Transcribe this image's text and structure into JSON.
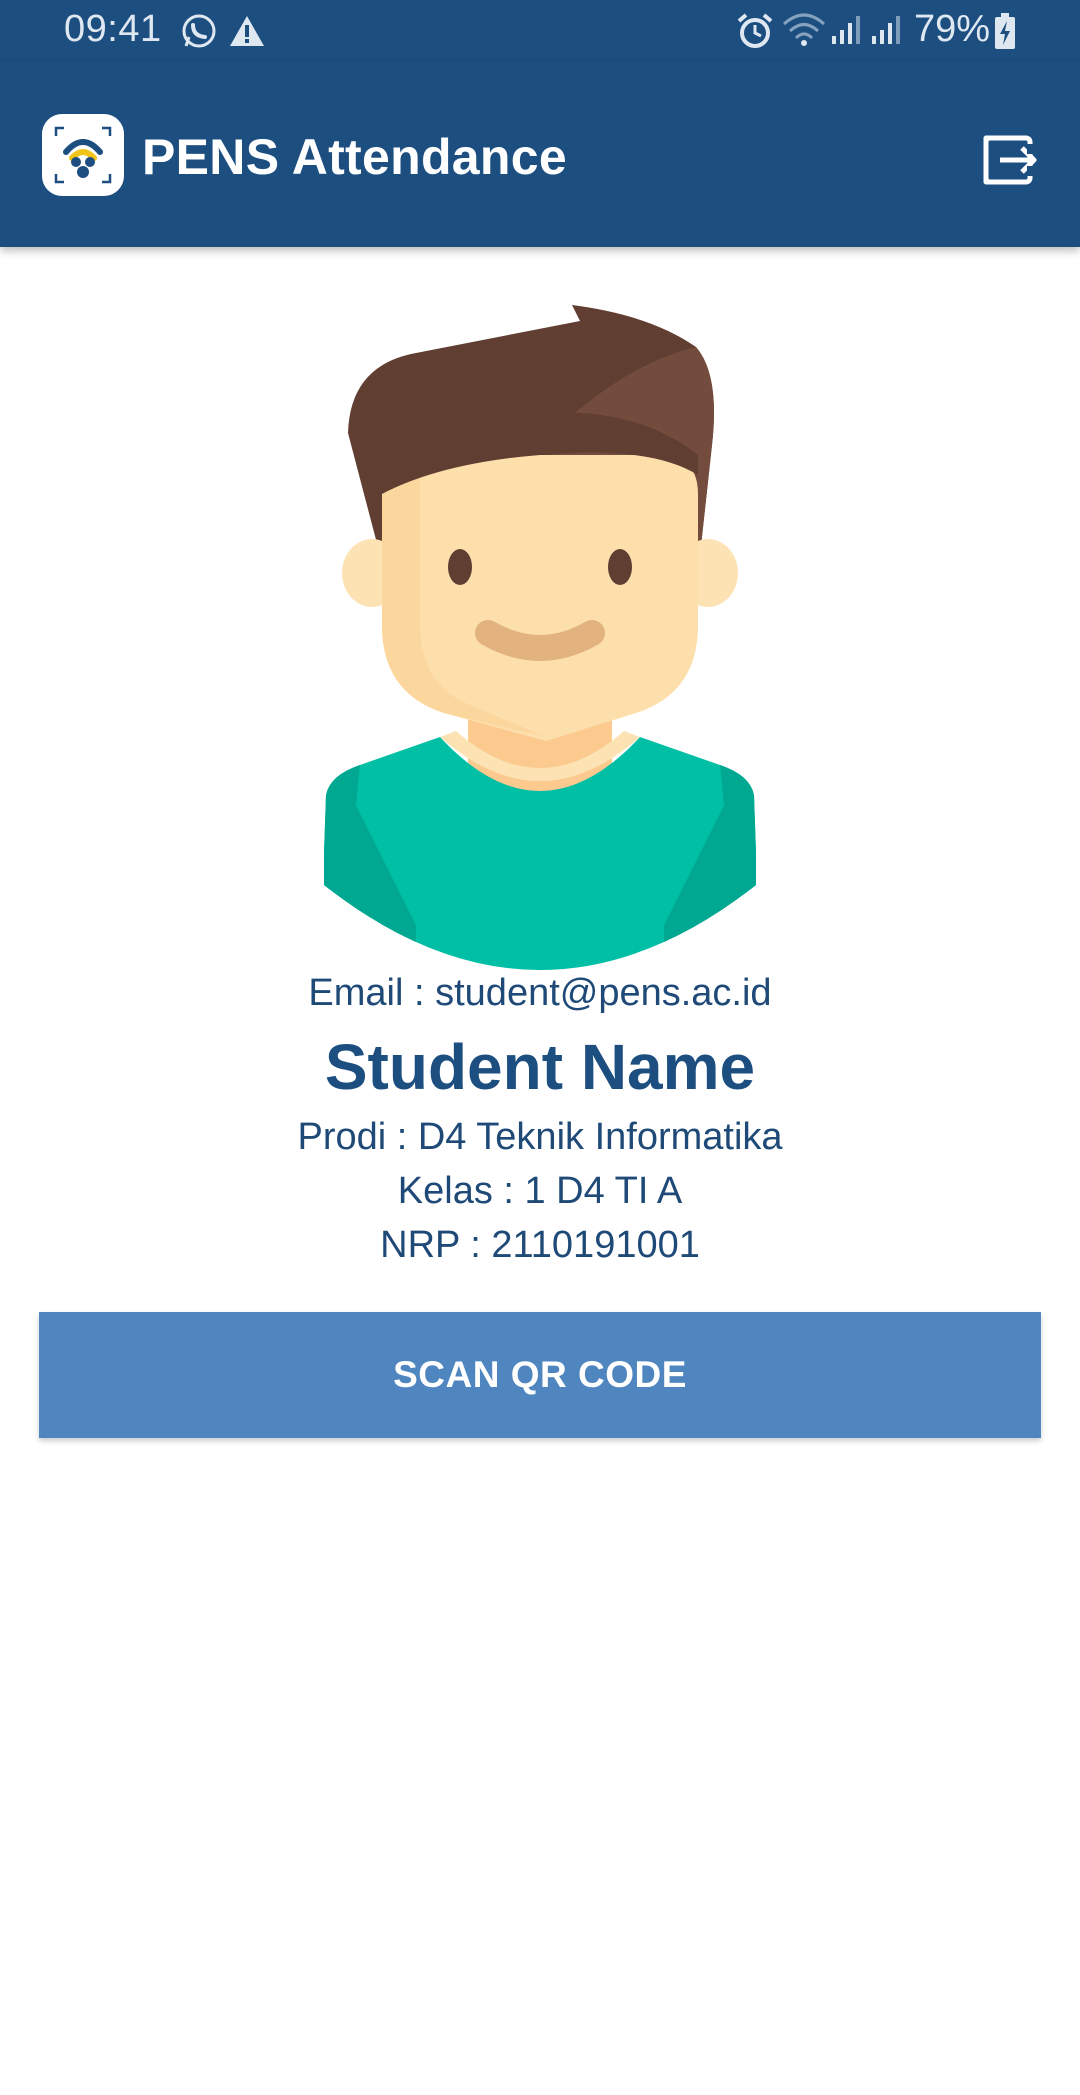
{
  "status_bar": {
    "time": "09:41",
    "battery": "79%",
    "icons": [
      "whatsapp-icon",
      "warning-icon",
      "alarm-icon",
      "wifi-icon",
      "signal-icon",
      "signal-icon",
      "battery-charging-icon"
    ]
  },
  "app_bar": {
    "title": "PENS Attendance",
    "logout_icon": "logout-icon",
    "background_color": "#1c4e80"
  },
  "profile": {
    "email": "Email : student@pens.ac.id",
    "name": "Student Name",
    "prodi": "Prodi : D4 Teknik Informatika",
    "kelas": "Kelas : 1 D4 TI A",
    "nrp": "NRP : 2110191001"
  },
  "actions": {
    "scan_label": "SCAN QR CODE",
    "button_color": "#4f86c0"
  }
}
